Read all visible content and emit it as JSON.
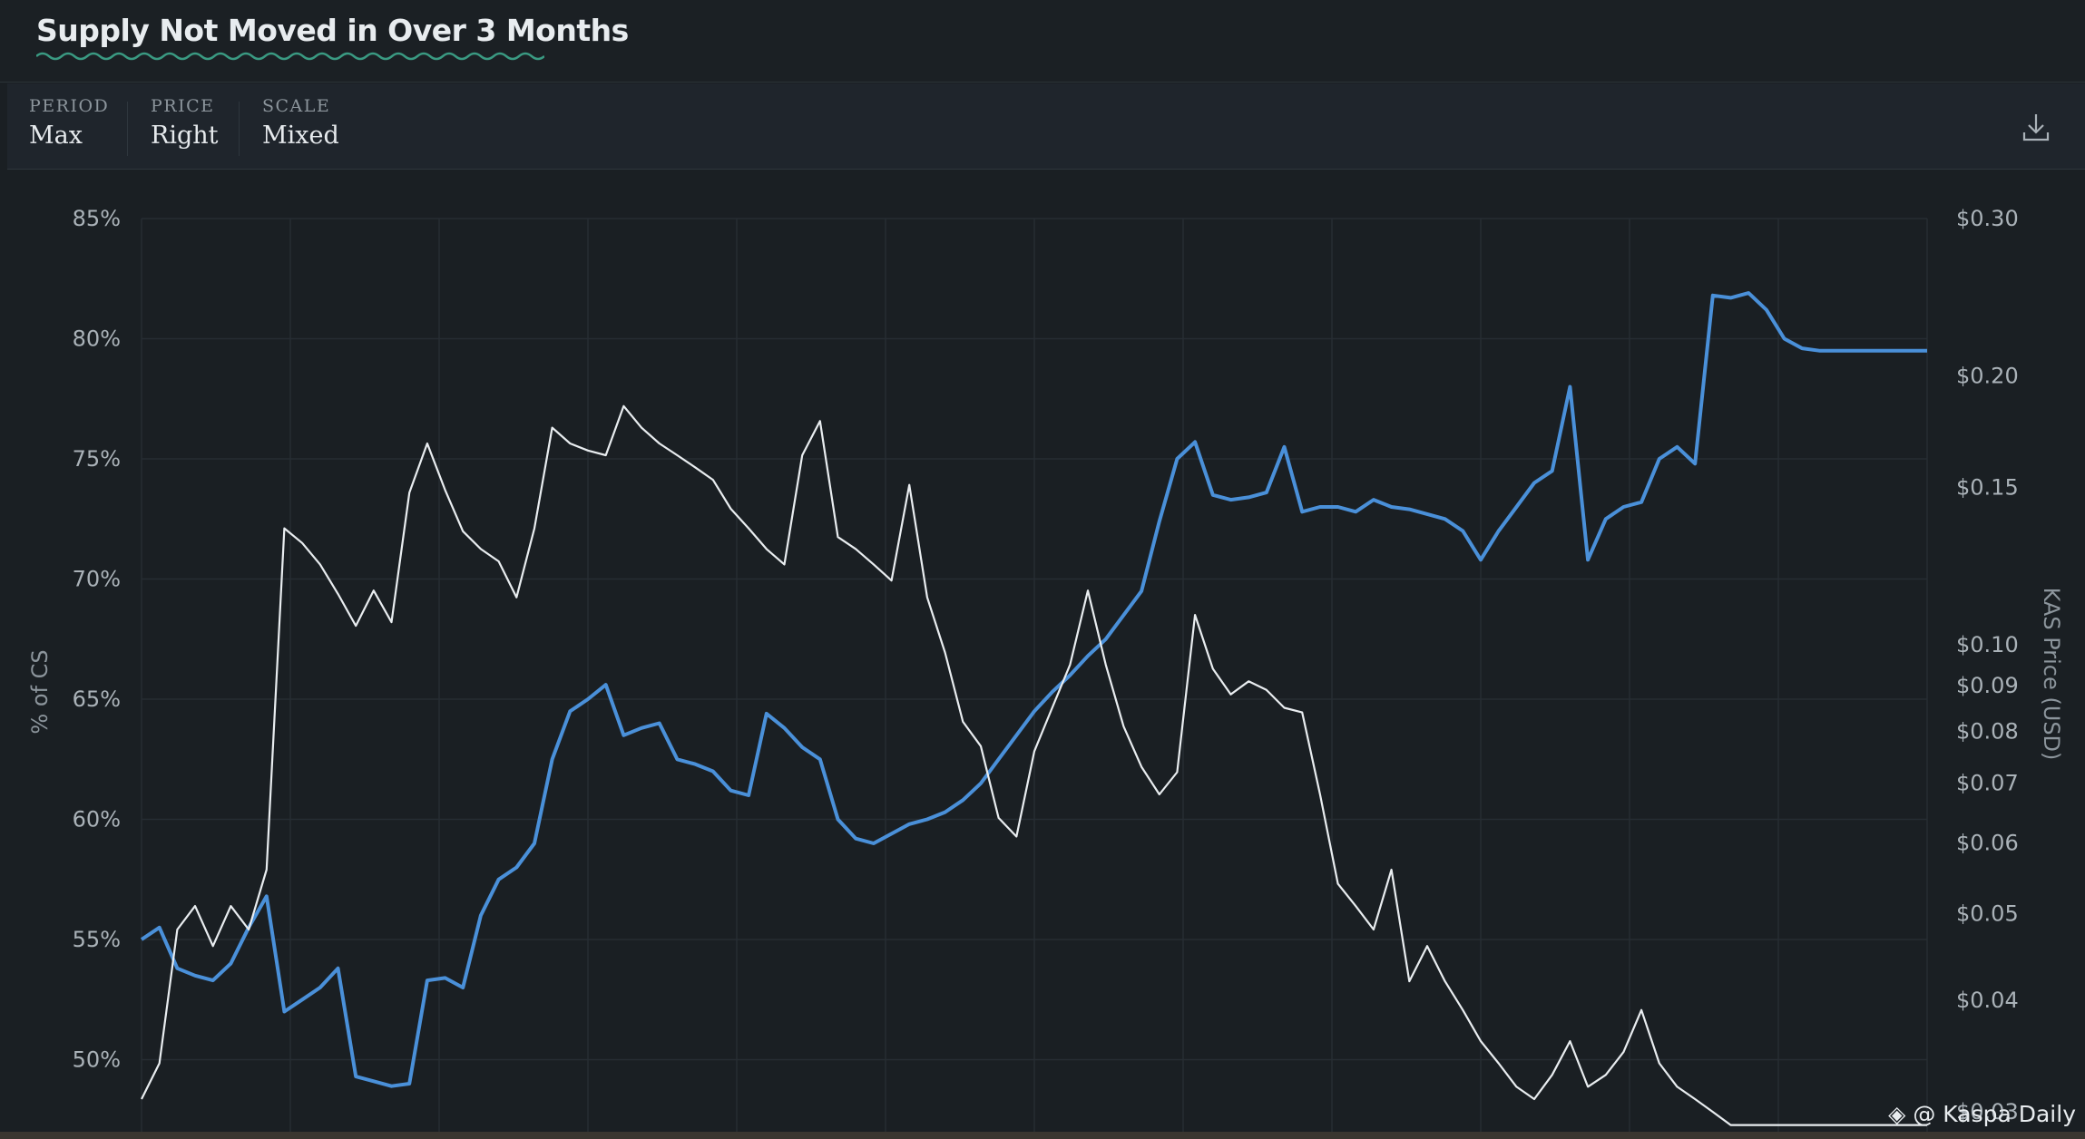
{
  "header": {
    "title": "Supply Not Moved in Over 3 Months"
  },
  "controls": [
    {
      "label": "PERIOD",
      "value": "Max"
    },
    {
      "label": "PRICE",
      "value": "Right"
    },
    {
      "label": "SCALE",
      "value": "Mixed"
    }
  ],
  "icons": {
    "download": "download-icon"
  },
  "watermark": {
    "text": "@ Kaspa Daily"
  },
  "colors": {
    "supply": "#4a90d9",
    "price": "#e9edf0",
    "background": "#1a1f23"
  },
  "chart_data": {
    "type": "line",
    "title": "",
    "ylabel": "% of CS",
    "y2label": "KAS Price (USD)",
    "ylim": [
      47,
      85
    ],
    "y_ticks": [
      "85%",
      "80%",
      "75%",
      "70%",
      "65%",
      "60%",
      "55%",
      "50%"
    ],
    "y2_scale": "log",
    "y2lim": [
      0.0285,
      0.3
    ],
    "y2_ticks": [
      "$0.30",
      "$0.20",
      "$0.15",
      "$0.10",
      "$0.09",
      "$0.08",
      "$0.07",
      "$0.06",
      "$0.05",
      "$0.04",
      "$0.03"
    ],
    "grid": true,
    "x": [
      0,
      1,
      2,
      3,
      4,
      5,
      6,
      7,
      8,
      9,
      10,
      11,
      12,
      13,
      14,
      15,
      16,
      17,
      18,
      19,
      20,
      21,
      22,
      23,
      24,
      25,
      26,
      27,
      28,
      29,
      30,
      31,
      32,
      33,
      34,
      35,
      36,
      37,
      38,
      39,
      40,
      41,
      42,
      43,
      44,
      45,
      46,
      47,
      48,
      49,
      50,
      51,
      52,
      53,
      54,
      55,
      56,
      57,
      58,
      59,
      60,
      61,
      62,
      63,
      64,
      65,
      66,
      67,
      68,
      69,
      70,
      71,
      72,
      73,
      74,
      75,
      76,
      77,
      78,
      79,
      80,
      81,
      82,
      83,
      84,
      85,
      86,
      87,
      88,
      89,
      90,
      91,
      92,
      93,
      94,
      95,
      96,
      97,
      98,
      99,
      100
    ],
    "series": [
      {
        "name": "",
        "axis": "left",
        "values": [
          55.0,
          55.5,
          53.8,
          53.5,
          53.3,
          54.0,
          55.5,
          56.8,
          52.0,
          52.5,
          53.0,
          53.8,
          49.3,
          49.1,
          48.9,
          49.0,
          53.3,
          53.4,
          53.0,
          56.0,
          57.5,
          58.0,
          59.0,
          62.5,
          64.5,
          65.0,
          65.6,
          63.5,
          63.8,
          64.0,
          62.5,
          62.3,
          62.0,
          61.2,
          61.0,
          64.4,
          63.8,
          63.0,
          62.5,
          60.0,
          59.2,
          59.0,
          59.4,
          59.8,
          60.0,
          60.3,
          60.8,
          61.5,
          62.5,
          63.5,
          64.5,
          65.3,
          66.0,
          66.8,
          67.5,
          68.5,
          69.5,
          72.4,
          75.0,
          75.7,
          73.5,
          73.3,
          73.4,
          73.6,
          75.5,
          72.8,
          73.0,
          73.0,
          72.8,
          73.3,
          73.0,
          72.9,
          72.7,
          72.5,
          72.0,
          70.8,
          72.0,
          73.0,
          74.0,
          74.5,
          78.0,
          70.8,
          72.5,
          73.0,
          73.2,
          75.0,
          75.5,
          74.8,
          81.8,
          81.7,
          81.9,
          81.2,
          80.0,
          79.6,
          79.5,
          79.5,
          79.5,
          79.5,
          79.5,
          79.5,
          79.5
        ]
      },
      {
        "name": "",
        "axis": "right",
        "values": [
          0.031,
          0.034,
          0.048,
          0.051,
          0.046,
          0.051,
          0.048,
          0.056,
          0.135,
          0.13,
          0.123,
          0.114,
          0.105,
          0.115,
          0.106,
          0.148,
          0.168,
          0.149,
          0.134,
          0.128,
          0.124,
          0.113,
          0.135,
          0.175,
          0.168,
          0.165,
          0.163,
          0.185,
          0.175,
          0.168,
          0.163,
          0.158,
          0.153,
          0.142,
          0.135,
          0.128,
          0.123,
          0.163,
          0.178,
          0.132,
          0.128,
          0.123,
          0.118,
          0.151,
          0.113,
          0.098,
          0.082,
          0.077,
          0.064,
          0.061,
          0.076,
          0.085,
          0.095,
          0.115,
          0.095,
          0.081,
          0.073,
          0.068,
          0.072,
          0.108,
          0.094,
          0.088,
          0.091,
          0.089,
          0.085,
          0.084,
          0.068,
          0.054,
          0.051,
          0.048,
          0.056,
          0.042,
          0.046,
          0.042,
          0.039,
          0.036,
          0.034,
          0.032,
          0.031,
          0.033,
          0.036,
          0.032,
          0.033,
          0.035,
          0.039,
          0.034,
          0.032,
          0.031,
          0.03,
          0.029,
          0.029,
          0.029,
          0.029,
          0.029,
          0.029,
          0.029,
          0.029,
          0.029,
          0.029,
          0.029,
          0.029
        ]
      }
    ]
  }
}
